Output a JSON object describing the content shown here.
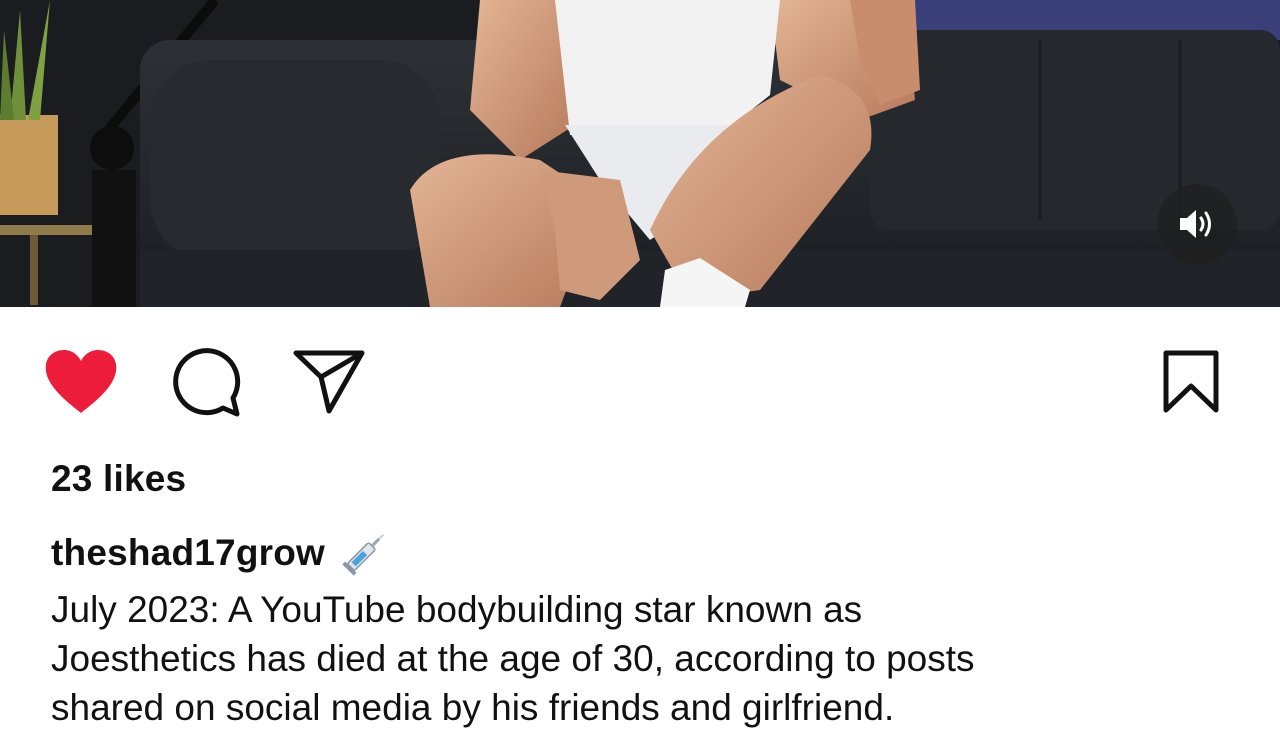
{
  "post": {
    "likes_text": "23 likes",
    "username": "theshad17grow",
    "username_emoji": "syringe-emoji",
    "caption": "July 2023: A YouTube bodybuilding star known as\nJoesthetics has died at the age of 30, according to posts\nshared on social media by his friends and girlfriend."
  },
  "actions": {
    "like_state": "liked",
    "like_color": "#ed1c3b",
    "icon_color": "#111111"
  },
  "media": {
    "type": "video",
    "audio_state": "on"
  }
}
